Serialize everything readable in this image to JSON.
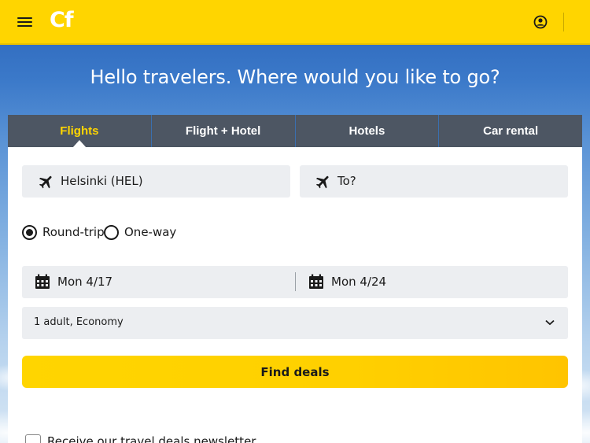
{
  "header": {
    "logo_text": "Cf",
    "menu_icon": "hamburger-menu-icon",
    "account_icon": "user-circle-icon",
    "brand_color": "#ffd500"
  },
  "hero": {
    "headline": "Hello travelers. Where would you like to go?"
  },
  "tabs": [
    {
      "label": "Flights",
      "active": true
    },
    {
      "label": "Flight + Hotel",
      "active": false
    },
    {
      "label": "Hotels",
      "active": false
    },
    {
      "label": "Car rental",
      "active": false
    }
  ],
  "search": {
    "origin": {
      "value": "Helsinki (HEL)",
      "icon": "airplane-icon"
    },
    "destination": {
      "placeholder": "To?",
      "icon": "airplane-icon"
    },
    "trip_type": {
      "options": [
        {
          "label": "Round-trip",
          "selected": true
        },
        {
          "label": "One-way",
          "selected": false
        }
      ]
    },
    "depart_date": {
      "value": "Mon 4/17",
      "icon": "calendar-icon"
    },
    "return_date": {
      "value": "Mon 4/24",
      "icon": "calendar-icon"
    },
    "passengers": {
      "value": "1 adult, Economy",
      "icon": "chevron-down-icon"
    },
    "submit_label": "Find deals"
  },
  "newsletter": {
    "label": "Receive our travel deals newsletter",
    "checked": false
  }
}
